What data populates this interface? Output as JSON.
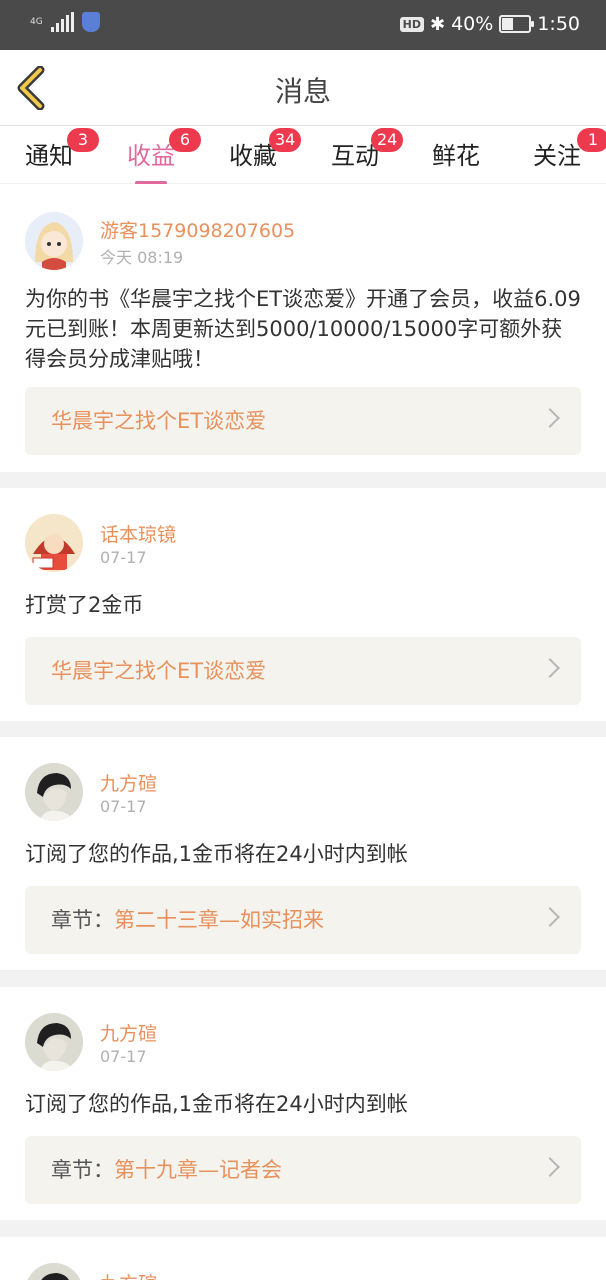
{
  "status_bar": {
    "network": "4G",
    "hd_label": "HD",
    "battery_percent": "40%",
    "battery_level": 0.4,
    "time": "1:50",
    "icons": [
      "signal-icon",
      "shield-icon",
      "bluetooth-icon",
      "battery-icon"
    ]
  },
  "header": {
    "title": "消息",
    "back_icon": "chevron-left-icon"
  },
  "tabs": [
    {
      "label": "通知",
      "badge": "3",
      "active": false
    },
    {
      "label": "收益",
      "badge": "6",
      "active": true
    },
    {
      "label": "收藏",
      "badge": "34",
      "active": false
    },
    {
      "label": "互动",
      "badge": "24",
      "active": false
    },
    {
      "label": "鲜花",
      "badge": "",
      "active": false
    },
    {
      "label": "关注",
      "badge": "1",
      "active": false
    }
  ],
  "messages": [
    {
      "name": "游客1579098207605",
      "time": "今天 08:19",
      "text": "为你的书《华晨宇之找个ET谈恋爱》开通了会员，收益6.09元已到账！本周更新达到5000/10000/15000字可额外获得会员分成津贴哦！",
      "link_prefix": "",
      "link_text": "华晨宇之找个ET谈恋爱"
    },
    {
      "name": "话本琼镜",
      "time": "07-17",
      "text": "打赏了2金币",
      "link_prefix": "",
      "link_text": "华晨宇之找个ET谈恋爱"
    },
    {
      "name": "九方碹",
      "time": "07-17",
      "text": "订阅了您的作品,1金币将在24小时内到帐",
      "link_prefix": "章节：",
      "link_text": "第二十三章—如实招来"
    },
    {
      "name": "九方碹",
      "time": "07-17",
      "text": "订阅了您的作品,1金币将在24小时内到帐",
      "link_prefix": "章节：",
      "link_text": "第十九章—记者会"
    },
    {
      "name": "九方碹",
      "time": "",
      "text": "",
      "link_prefix": "",
      "link_text": ""
    }
  ],
  "colors": {
    "accent": "#e06a9c",
    "name": "#e8915c",
    "badge": "#ee3a4e",
    "status_bar": "#4a4a4a"
  }
}
